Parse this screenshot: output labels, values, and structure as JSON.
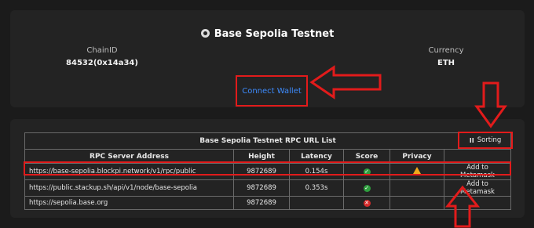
{
  "network": {
    "title": "Base Sepolia Testnet",
    "chain_id_label": "ChainID",
    "chain_id_value": "84532(0x14a34)",
    "currency_label": "Currency",
    "currency_value": "ETH",
    "connect_label": "Connect Wallet"
  },
  "rpc_table": {
    "title": "Base Sepolia Testnet RPC URL List",
    "sorting_label": "Sorting",
    "headers": [
      "RPC Server Address",
      "Height",
      "Latency",
      "Score",
      "Privacy",
      ""
    ],
    "rows": [
      {
        "address": "https://base-sepolia.blockpi.network/v1/rpc/public",
        "height": "9872689",
        "latency": "0.154s",
        "score": "ok",
        "privacy": "warning",
        "action": "Add to Metamask"
      },
      {
        "address": "https://public.stackup.sh/api/v1/node/base-sepolia",
        "height": "9872689",
        "latency": "0.353s",
        "score": "ok",
        "privacy": "",
        "action": "Add to Metamask"
      },
      {
        "address": "https://sepolia.base.org",
        "height": "9872689",
        "latency": "",
        "score": "bad",
        "privacy": "",
        "action": ""
      }
    ]
  },
  "colors": {
    "annotation_red": "#e21b1b",
    "link_blue": "#3d8bfd",
    "score_ok": "#2e9e3e",
    "score_bad": "#d62b2b",
    "warning": "#f0a81c"
  }
}
